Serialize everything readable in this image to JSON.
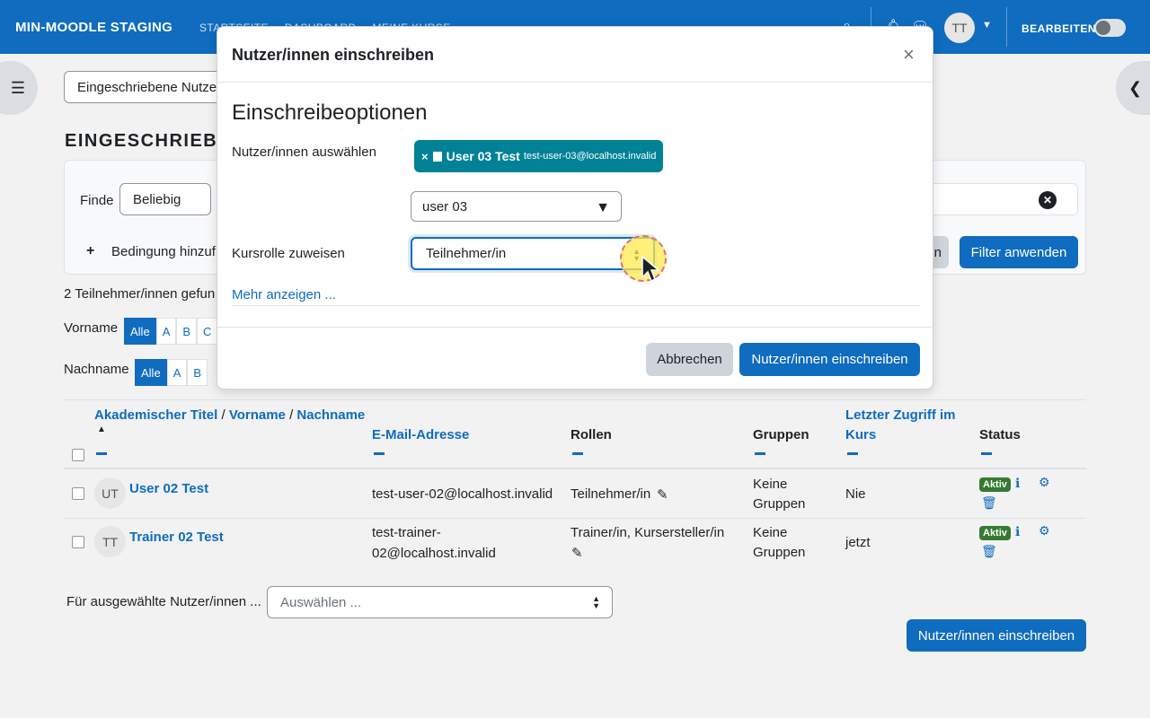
{
  "navbar": {
    "brand": "MIN-MOODLE STAGING",
    "links": [
      "STARTSEITE",
      "DASHBOARD",
      "MEINE KURSE"
    ],
    "avatar_initials": "TT",
    "edit_label": "BEARBEITEN",
    "accent": "#0f6cbf"
  },
  "page": {
    "participants_select": "Eingeschriebene Nutzer",
    "heading": "EINGESCHRIEBEN",
    "filter": {
      "find_label": "Finde",
      "match_select": "Beliebig",
      "add_condition": "Bedingung hinzuf",
      "clear_button": "n",
      "apply_button": "Filter anwenden"
    },
    "count_text": "2 Teilnehmer/innen gefun",
    "firstname_label": "Vorname",
    "firstname_letters": [
      "Alle",
      "A",
      "B",
      "C"
    ],
    "lastname_label": "Nachname",
    "lastname_letters": [
      "Alle",
      "A",
      "B"
    ]
  },
  "table": {
    "headers": {
      "title": "Akademischer Titel",
      "sep": "/",
      "firstname": "Vorname",
      "lastname": "Nachname",
      "email": "E-Mail-Adresse",
      "roles": "Rollen",
      "groups": "Gruppen",
      "last_access_1": "Letzter Zugriff im",
      "last_access_2": "Kurs",
      "status": "Status"
    },
    "rows": [
      {
        "initials": "UT",
        "name": "User 02 Test",
        "email_1": "test-user-02@localhost.invalid",
        "email_2": "",
        "roles_1": "Teilnehmer/in",
        "roles_2": "",
        "groups_1": "Keine",
        "groups_2": "Gruppen",
        "last_access": "Nie",
        "status": "Aktiv"
      },
      {
        "initials": "TT",
        "name": "Trainer 02 Test",
        "email_1": "test-trainer-",
        "email_2": "02@localhost.invalid",
        "roles_1": "Trainer/in, Kursersteller/in",
        "roles_2": "",
        "groups_1": "Keine",
        "groups_2": "Gruppen",
        "last_access": "jetzt",
        "status": "Aktiv"
      }
    ]
  },
  "bulk": {
    "label": "Für ausgewählte Nutzer/innen ...",
    "select": "Auswählen ...",
    "enrol_button": "Nutzer/innen einschreiben"
  },
  "modal": {
    "title": "Nutzer/innen einschreiben",
    "close": "×",
    "section_title": "Einschreibeoptionen",
    "select_users_label": "Nutzer/innen auswählen",
    "chip_remove": "×",
    "chip_name": "User 03 Test",
    "chip_email": "test-user-03@localhost.invalid",
    "search_value": "user 03",
    "role_label": "Kursrolle zuweisen",
    "role_value": "Teilnehmer/in",
    "more_link": "Mehr anzeigen ...",
    "cancel_button": "Abbrechen",
    "submit_button": "Nutzer/innen einschreiben"
  }
}
